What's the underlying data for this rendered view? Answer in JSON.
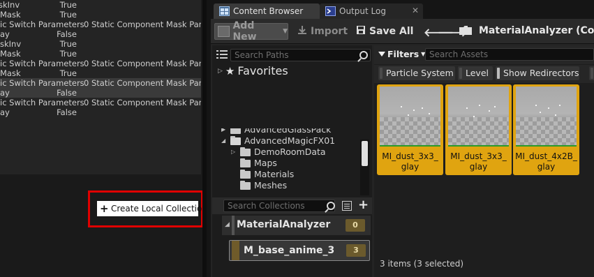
{
  "details": {
    "rows": [
      {
        "name": "skInv",
        "value": "True",
        "ext": ""
      },
      {
        "name": "Mask",
        "value": "True",
        "ext": ""
      },
      {
        "name": "ic Switch Parameters",
        "value": "",
        "ext": "0 Static Component Mask Para"
      },
      {
        "name": "ay",
        "value": "False",
        "ext": ""
      },
      {
        "name": "skInv",
        "value": "True",
        "ext": ""
      },
      {
        "name": "Mask",
        "value": "True",
        "ext": ""
      },
      {
        "name": "ic Switch Parameters",
        "value": "",
        "ext": "0 Static Component Mask Para"
      },
      {
        "name": "Mask",
        "value": "True",
        "ext": ""
      },
      {
        "name": "ic Switch Parameters",
        "value": "",
        "ext": "0 Static Component Mask Para"
      },
      {
        "name": "ay",
        "value": "False",
        "ext": ""
      },
      {
        "name": "ic Switch Parameters",
        "value": "",
        "ext": "0 Static Component Mask Para"
      },
      {
        "name": "ay",
        "value": "False",
        "ext": ""
      }
    ]
  },
  "context_menu": {
    "create_local_collection": "Create Local Collection",
    "highlight_color": "#e00000"
  },
  "tabs": [
    {
      "label": "Content Browser",
      "icon": "content-browser-icon",
      "active": true
    },
    {
      "label": "Output Log",
      "icon": "output-log-icon",
      "active": false
    }
  ],
  "toolbar": {
    "add_new": "Add New",
    "import": "Import",
    "save_all": "Save All",
    "path": "MaterialAnalyzer (Collec"
  },
  "sources": {
    "search_paths_placeholder": "Search Paths",
    "favorites": "Favorites",
    "tree": [
      {
        "label": "AdvancedGlassPack",
        "open": false
      },
      {
        "label": "AdvancedMagicFX01",
        "open": true
      },
      {
        "label": "DemoRoomData",
        "open": false
      },
      {
        "label": "Maps",
        "open": false
      },
      {
        "label": "Materials",
        "open": false
      },
      {
        "label": "Meshes",
        "open": false
      }
    ],
    "search_collections_placeholder": "Search Collections",
    "collection_group": {
      "name": "MaterialAnalyzer",
      "count": "0"
    },
    "collection_item": {
      "name": "M_base_anime_3",
      "count": "3"
    }
  },
  "assets": {
    "filters_label": "Filters",
    "search_placeholder": "Search Assets",
    "chips": [
      "Particle System",
      "Level",
      "Show Redirectors"
    ],
    "tiles": [
      {
        "line1": "MI_dust_3x3_",
        "line2": "glay"
      },
      {
        "line1": "MI_dust_3x3_",
        "line2": "glay"
      },
      {
        "line1": "MI_dust_4x2B_",
        "line2": "glay"
      }
    ],
    "status": "3 items (3 selected)",
    "selection_color": "#e0a410"
  }
}
